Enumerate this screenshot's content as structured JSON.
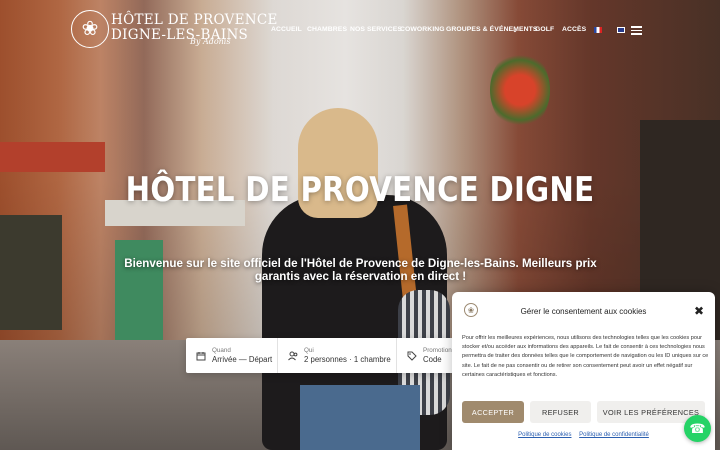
{
  "header": {
    "logo_line1": "HÔTEL DE PROVENCE",
    "logo_line2": "DIGNE-LES-BAINS",
    "logo_signature": "By Adonis",
    "nav": [
      "ACCUEIL",
      "CHAMBRES",
      "NOS SERVICES",
      "COWORKING",
      "GROUPES & ÉVÉNEMENTS",
      "GOLF",
      "ACCÈS"
    ],
    "groups_dropdown_icon": "chevron-down-icon",
    "languages": [
      "fr",
      "en"
    ]
  },
  "hero": {
    "title": "HÔTEL DE PROVENCE DIGNE",
    "subtitle": "Bienvenue sur le site officiel de l'Hôtel de Provence de Digne-les-Bains. Meilleurs prix garantis avec la réservation en direct !"
  },
  "booking": {
    "when_label": "Quand",
    "when_value": "Arrivée — Départ",
    "who_label": "Qui",
    "who_value": "2 personnes · 1 chambre",
    "promo_label": "Promotion",
    "promo_value": "Code"
  },
  "cookie": {
    "title": "Gérer le consentement aux cookies",
    "body": "Pour offrir les meilleures expériences, nous utilisons des technologies telles que les cookies pour stocker et/ou accéder aux informations des appareils. Le fait de consentir à ces technologies nous permettra de traiter des données telles que le comportement de navigation ou les ID uniques sur ce site. Le fait de ne pas consentir ou de retirer son consentement peut avoir un effet négatif sur certaines caractéristiques et fonctions.",
    "accept": "ACCEPTER",
    "refuse": "REFUSER",
    "preferences": "VOIR LES PRÉFÉRENCES",
    "cookie_policy": "Politique de cookies",
    "privacy_policy": "Politique de confidentialité"
  },
  "colors": {
    "accent": "#a08a6d",
    "whatsapp": "#25d366",
    "link": "#2b5fb0"
  }
}
